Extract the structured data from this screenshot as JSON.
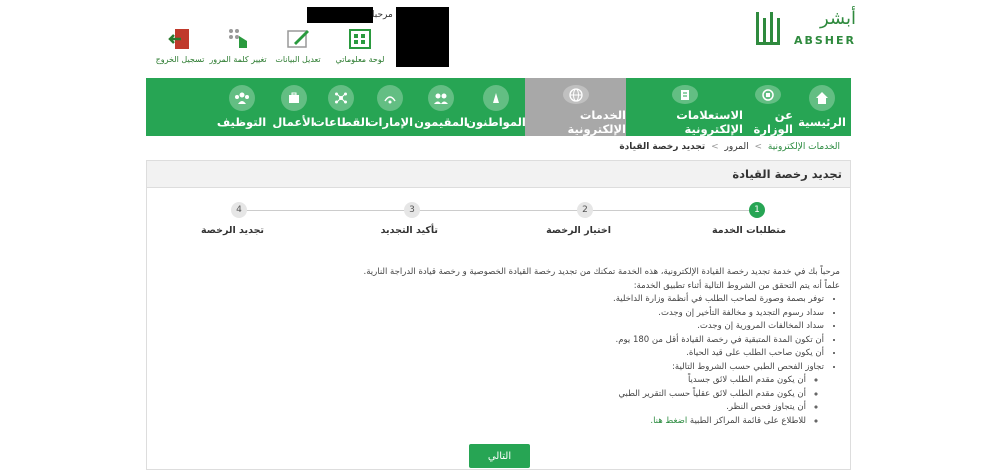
{
  "header": {
    "logo_ar": "أبشر",
    "logo_en": "ABSHER",
    "welcome": "مرحبا",
    "utilities": [
      {
        "label": "تسجيل الخروج",
        "icon": "logout-icon"
      },
      {
        "label": "تغيير كلمة المرور",
        "icon": "change-password-icon"
      },
      {
        "label": "تعديل البيانات",
        "icon": "edit-data-icon"
      },
      {
        "label": "لوحة معلوماتي",
        "icon": "dashboard-icon"
      }
    ]
  },
  "nav": {
    "items": [
      {
        "label": "الرئيسية",
        "icon": "home-icon"
      },
      {
        "label": "عن الوزارة",
        "icon": "ministry-icon"
      },
      {
        "label": "الاستعلامات الإلكترونية",
        "icon": "inquiries-icon"
      },
      {
        "label": "الخدمات الإلكترونية",
        "icon": "globe-icon",
        "active": true
      },
      {
        "label": "المواطنون",
        "icon": "citizens-icon"
      },
      {
        "label": "المقيمون",
        "icon": "residents-icon"
      },
      {
        "label": "الإمارات",
        "icon": "emirates-icon"
      },
      {
        "label": "القطاعات",
        "icon": "sectors-icon"
      },
      {
        "label": "الأعمال",
        "icon": "business-icon"
      },
      {
        "label": "التوظيف",
        "icon": "employment-icon"
      }
    ]
  },
  "breadcrumb": {
    "items": [
      "الخدمات الإلكترونية",
      "المرور",
      "تجديد رخصة القيادة"
    ],
    "separator": ">"
  },
  "panel": {
    "title": "تجديد رخصة القيادة",
    "steps": [
      {
        "number": "1",
        "label": "متطلبات الخدمة",
        "active": true
      },
      {
        "number": "2",
        "label": "اختيار الرخصة"
      },
      {
        "number": "3",
        "label": "تأكيد التجديد"
      },
      {
        "number": "4",
        "label": "تجديد الرخصة"
      }
    ],
    "intro": "مرحباً بك في خدمة تجديد رخصة القيادة الإلكترونية، هذه الخدمة تمكنك من تجديد رخصة القيادة الخصوصية و رخصة قيادة الدراجة النارية.",
    "conditions_intro": "علماً أنه يتم التحقق من الشروط التالية أثناء تطبيق الخدمة:",
    "conditions": [
      "توفر بصمة وصورة لصاحب الطلب في أنظمة وزارة الداخلية.",
      "سداد رسوم التجديد و مخالفة التأخير إن وجدت.",
      "سداد المخالفات المرورية إن وجدت.",
      "أن تكون المدة المتبقية في رخصة القيادة أقل من 180 يوم.",
      "أن يكون صاحب الطلب على قيد الحياة.",
      "تجاوز الفحص الطبي حسب الشروط التالية:"
    ],
    "medical_conditions": [
      "أن يكون مقدم الطلب لائق جسدياً",
      "أن يكون مقدم الطلب لائق عقلياً حسب التقرير الطبي",
      "أن يتجاوز فحص النظر.",
      "للاطلاع على قائمة المراكز الطبية"
    ],
    "medical_link": "اضغط هنا.",
    "next_button": "التالي"
  },
  "colors": {
    "brand_green": "#27a554",
    "active_nav": "#a8a8a8",
    "link_green": "#2a8a3e"
  }
}
